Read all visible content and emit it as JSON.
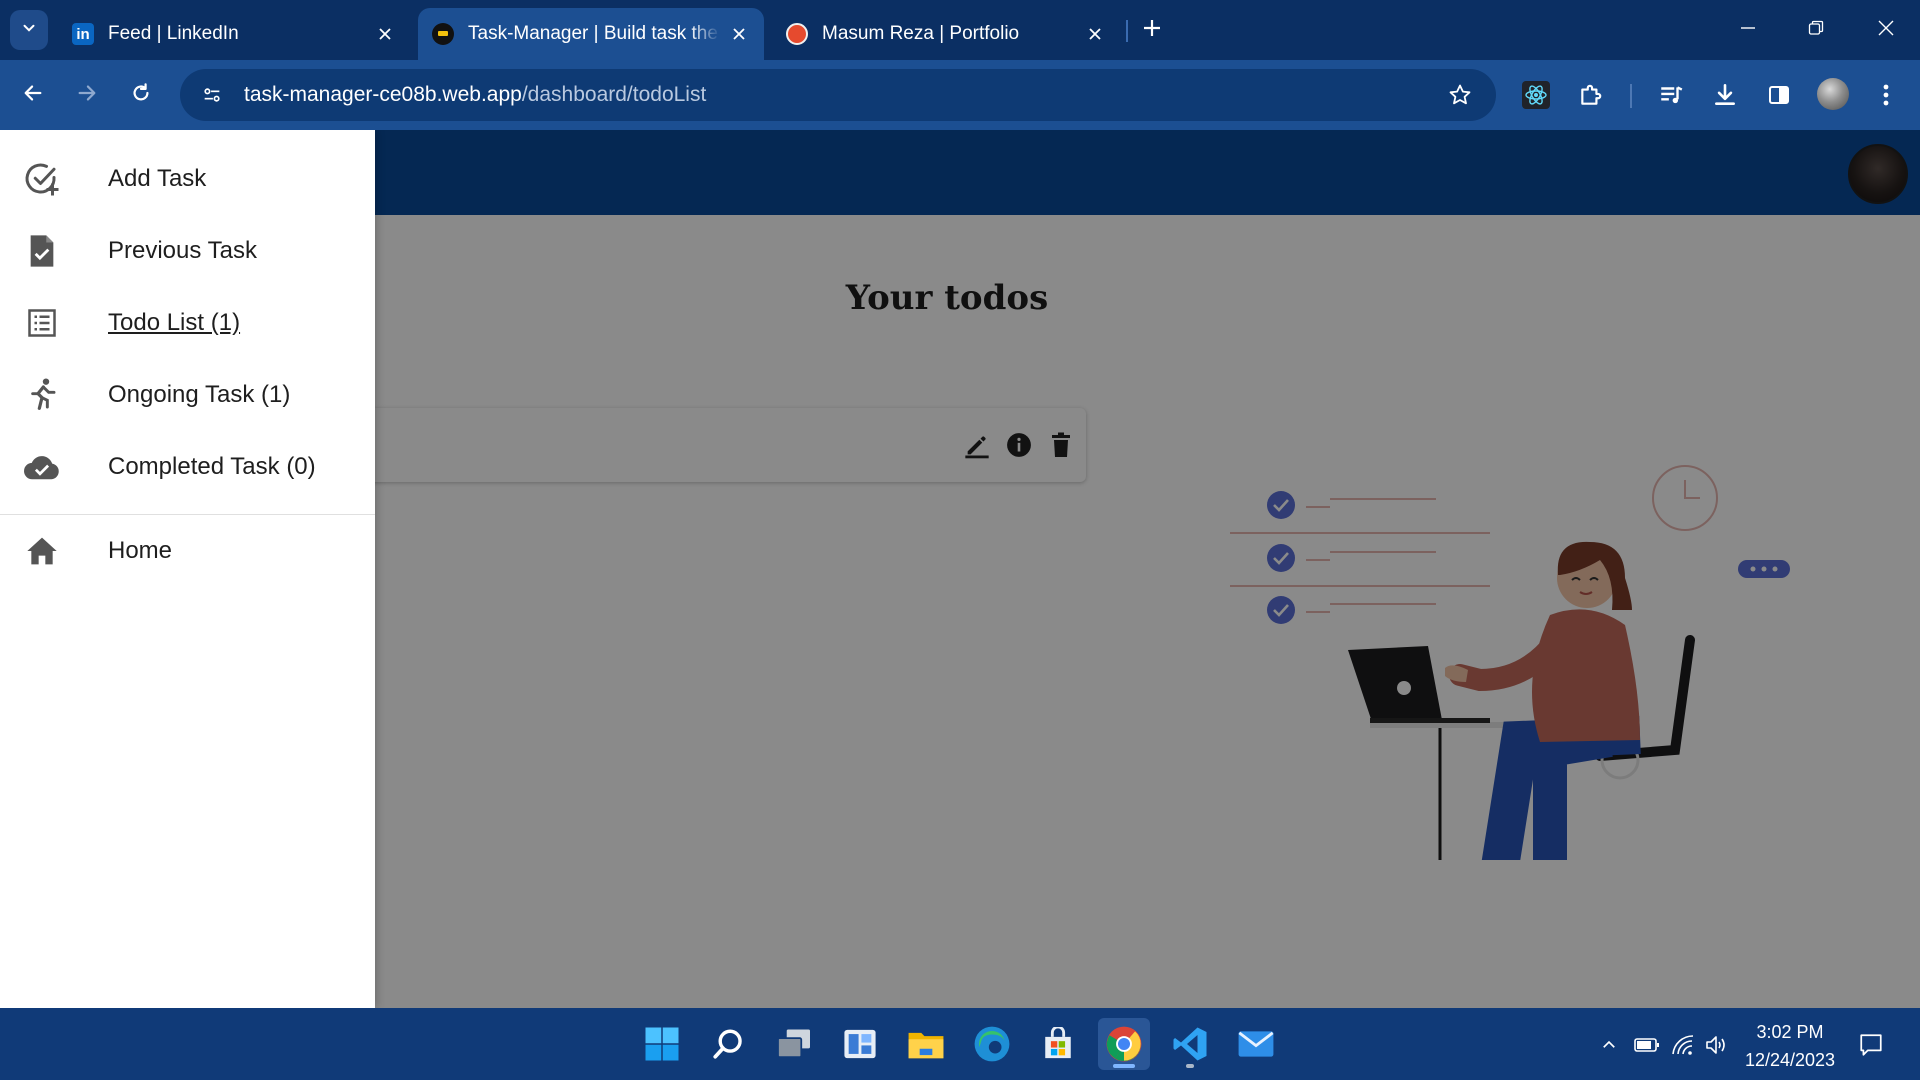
{
  "browser": {
    "tabs": [
      {
        "title": "Feed | LinkedIn",
        "favicon": "linkedin-icon",
        "active": false
      },
      {
        "title": "Task-Manager | Build task the w",
        "favicon": "task-manager-icon",
        "active": true
      },
      {
        "title": "Masum Reza | Portfolio",
        "favicon": "portfolio-icon",
        "active": false
      }
    ],
    "url_host": "task-manager-ce08b.web.app",
    "url_path": "/dashboard/todoList"
  },
  "drawer": {
    "items": [
      {
        "label": "Add Task",
        "icon": "add-task-icon"
      },
      {
        "label": "Previous Task",
        "icon": "document-check-icon"
      },
      {
        "label": "Todo List (1)",
        "icon": "list-icon"
      },
      {
        "label": "Ongoing Task (1)",
        "icon": "running-person-icon"
      },
      {
        "label": "Completed Task (0)",
        "icon": "cloud-check-icon"
      }
    ],
    "home": {
      "label": "Home",
      "icon": "home-icon"
    }
  },
  "main": {
    "title": "Your todos"
  },
  "taskbar": {
    "time": "3:02 PM",
    "date": "12/24/2023",
    "apps": [
      "windows-start-icon",
      "search-icon",
      "task-view-icon",
      "widgets-icon",
      "file-explorer-icon",
      "edge-icon",
      "store-icon",
      "chrome-icon",
      "vscode-icon",
      "mail-icon"
    ]
  },
  "colors": {
    "tabbar": "#0b2f63",
    "toolbar": "#1c4f92",
    "app_header": "#0b4a9a",
    "taskbar": "#103a78",
    "accent_check": "#5b6fd6"
  }
}
